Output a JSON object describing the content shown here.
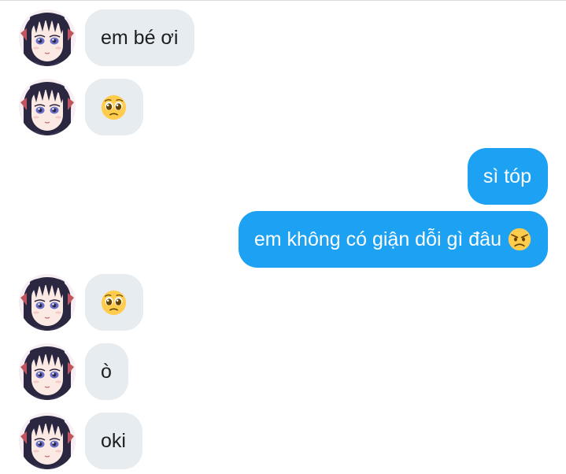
{
  "conversation": {
    "messages": [
      {
        "direction": "incoming",
        "text": "em bé ơi"
      },
      {
        "direction": "incoming",
        "text": "",
        "emoji": "pleading-face-emoji"
      },
      {
        "direction": "outgoing",
        "text": "sì tóp"
      },
      {
        "direction": "outgoing",
        "text": "em không có giận dỗi gì đâu",
        "emoji": "angry-face-emoji"
      },
      {
        "direction": "incoming",
        "text": "",
        "emoji": "pleading-face-emoji"
      },
      {
        "direction": "incoming",
        "text": "ò"
      },
      {
        "direction": "incoming",
        "text": "oki"
      }
    ]
  },
  "colors": {
    "incoming_bubble": "#e7ecf0",
    "outgoing_bubble": "#1da1f2",
    "incoming_text": "#1c1e21",
    "outgoing_text": "#ffffff"
  },
  "icons": {
    "avatar": "anime-girl-avatar",
    "emojis": [
      "pleading-face-emoji",
      "angry-face-emoji"
    ]
  }
}
